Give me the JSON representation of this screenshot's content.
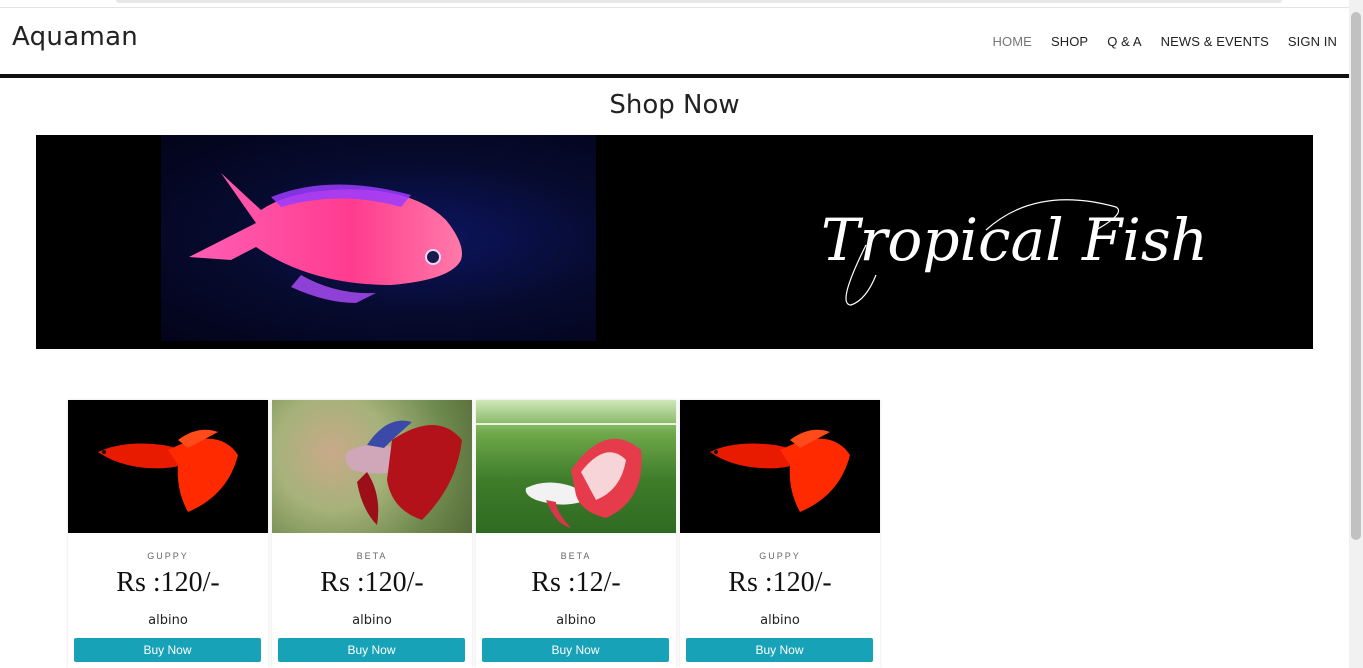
{
  "brand": {
    "title": "Aquaman"
  },
  "nav": {
    "items": [
      {
        "label": "HOME"
      },
      {
        "label": "SHOP"
      },
      {
        "label": "Q & A"
      },
      {
        "label": "NEWS & EVENTS"
      },
      {
        "label": "SIGN IN"
      }
    ]
  },
  "page": {
    "title": "Shop Now"
  },
  "banner": {
    "script_text": "Tropical Fish"
  },
  "products": [
    {
      "category": "GUPPY",
      "price": "Rs :120/-",
      "name": "albino",
      "button": "Buy Now"
    },
    {
      "category": "BETA",
      "price": "Rs :120/-",
      "name": "albino",
      "button": "Buy Now"
    },
    {
      "category": "BETA",
      "price": "Rs :12/-",
      "name": "albino",
      "button": "Buy Now"
    },
    {
      "category": "GUPPY",
      "price": "Rs :120/-",
      "name": "albino",
      "button": "Buy Now"
    }
  ],
  "colors": {
    "accent": "#17a2b8",
    "navbar_border": "#111111",
    "banner_bg": "#000000"
  }
}
